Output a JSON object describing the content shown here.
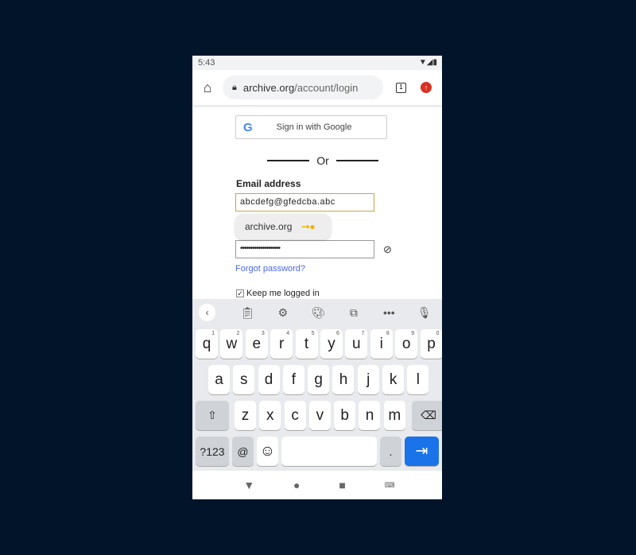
{
  "status": {
    "time": "5:43",
    "icons": [
      "wifi-icon",
      "signal-icon",
      "battery-icon"
    ]
  },
  "browser": {
    "url_domain": "archive.org",
    "url_path": "/account/login",
    "tab_count": "1"
  },
  "login": {
    "google_button": "Sign in with Google",
    "or": "Or",
    "email_label": "Email address",
    "email_value": "abcdefg@gfedcba.abc",
    "autocomplete": "archive.org",
    "password_value": "••••••••••••••••••••",
    "forgot": "Forgot password?",
    "keep_logged": "Keep me logged in"
  },
  "keyboard": {
    "row1": [
      [
        "q",
        "1"
      ],
      [
        "w",
        "2"
      ],
      [
        "e",
        "3"
      ],
      [
        "r",
        "4"
      ],
      [
        "t",
        "5"
      ],
      [
        "y",
        "6"
      ],
      [
        "u",
        "7"
      ],
      [
        "i",
        "8"
      ],
      [
        "o",
        "9"
      ],
      [
        "p",
        "0"
      ]
    ],
    "row2": [
      "a",
      "s",
      "d",
      "f",
      "g",
      "h",
      "j",
      "k",
      "l"
    ],
    "row3": [
      "z",
      "x",
      "c",
      "v",
      "b",
      "n",
      "m"
    ],
    "sym": "?123",
    "at": "@",
    "period": ".",
    "shift": "⇧",
    "backspace": "⌫",
    "enter": "⇥",
    "emoji": "☺"
  },
  "colors": {
    "accent": "#1a73e8",
    "email_border": "#c9a24a",
    "link": "#4a67f5",
    "key_icon": "#f1b400",
    "backdrop": "#02142a"
  }
}
